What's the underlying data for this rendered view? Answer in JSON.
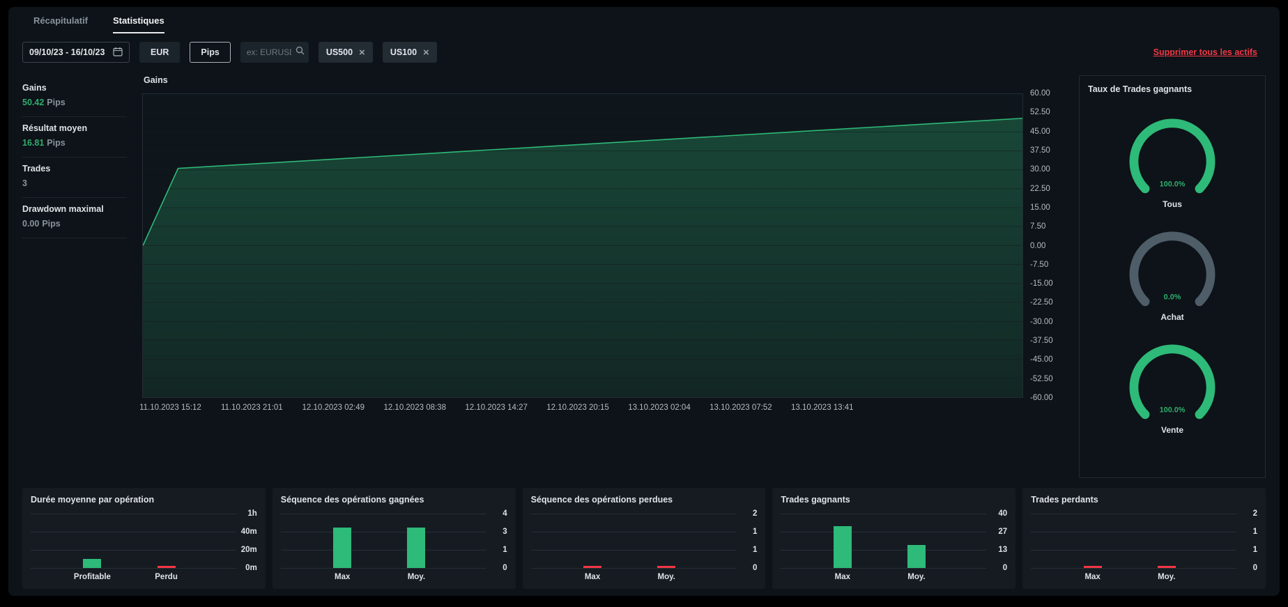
{
  "colors": {
    "bg": "#0d1318",
    "panel": "#151b21",
    "text": "#d6dade",
    "muted": "#8a929b",
    "accent-green": "#2eba78",
    "accent-green-text": "#2fad6e",
    "accent-red": "#f23645",
    "gauge-gray": "#4e5d68",
    "tick": "#b7bcc4",
    "border": "#232c33"
  },
  "tabs": [
    {
      "label": "Récapitulatif"
    },
    {
      "label": "Statistiques"
    }
  ],
  "toolbar": {
    "date_range": "09/10/23 - 16/10/23",
    "currency_button": "EUR",
    "unit_button": "Pips",
    "search_placeholder": "ex: EURUSD",
    "chips": [
      {
        "label": "US500",
        "remove": "×"
      },
      {
        "label": "US100",
        "remove": "×"
      }
    ],
    "remove_all_link": "Supprimer tous les actifs"
  },
  "stats": [
    {
      "id": "gains",
      "label": "Gains",
      "value": "50.42",
      "unit": "Pips",
      "tone": "green"
    },
    {
      "id": "resultat-moyen",
      "label": "Résultat moyen",
      "value": "16.81",
      "unit": "Pips",
      "tone": "green"
    },
    {
      "id": "trades",
      "label": "Trades",
      "value": "3",
      "unit": "",
      "tone": "muted"
    },
    {
      "id": "drawdown-maximal",
      "label": "Drawdown maximal",
      "value": "0.00",
      "unit": "Pips",
      "tone": "muted"
    }
  ],
  "chart_data": [
    {
      "id": "gains_line",
      "type": "area",
      "title": "Gains",
      "x_labels": [
        "11.10.2023 15:12",
        "11.10.2023 21:01",
        "12.10.2023 02:49",
        "12.10.2023 08:38",
        "12.10.2023 14:27",
        "12.10.2023 20:15",
        "13.10.2023 02:04",
        "13.10.2023 07:52",
        "13.10.2023 13:41"
      ],
      "y_tick_labels": [
        "60.00",
        "52.50",
        "45.00",
        "37.50",
        "30.00",
        "22.50",
        "15.00",
        "7.50",
        "0.00",
        "-7.50",
        "-15.00",
        "-22.50",
        "-30.00",
        "-37.50",
        "-45.00",
        "-52.50",
        "-60.00"
      ],
      "ylim": [
        -60,
        60
      ],
      "points": [
        {
          "x": 0,
          "y": 0
        },
        {
          "x": 0.04,
          "y": 30.6
        },
        {
          "x": 1,
          "y": 50.42
        }
      ]
    },
    {
      "id": "win_rate",
      "type": "gauge",
      "title": "Taux de Trades gagnants",
      "items": [
        {
          "label": "Tous",
          "value": 100,
          "display": "100.0%"
        },
        {
          "label": "Achat",
          "value": 0,
          "display": "0.0%"
        },
        {
          "label": "Vente",
          "value": 100,
          "display": "100.0%"
        }
      ]
    },
    {
      "id": "avg_duration",
      "type": "bar",
      "title": "Durée moyenne par opération",
      "categories": [
        "Profitable",
        "Perdu"
      ],
      "values": [
        10,
        0
      ],
      "bar_colors": [
        "green",
        "red"
      ],
      "y_ticks": [
        "1h",
        "40m",
        "20m",
        "0m"
      ],
      "ylim": [
        0,
        60
      ]
    },
    {
      "id": "win_streak",
      "type": "bar",
      "title": "Séquence des opérations gagnées",
      "categories": [
        "Max",
        "Moy."
      ],
      "values": [
        3,
        3
      ],
      "bar_colors": [
        "green",
        "green"
      ],
      "y_ticks": [
        "4",
        "3",
        "1",
        "0"
      ],
      "ylim": [
        0,
        4
      ]
    },
    {
      "id": "loss_streak",
      "type": "bar",
      "title": "Séquence des opérations perdues",
      "categories": [
        "Max",
        "Moy."
      ],
      "values": [
        0,
        0
      ],
      "bar_colors": [
        "red",
        "red"
      ],
      "y_ticks": [
        "2",
        "1",
        "1",
        "0"
      ],
      "ylim": [
        0,
        2
      ]
    },
    {
      "id": "winning_trades",
      "type": "bar",
      "title": "Trades gagnants",
      "categories": [
        "Max",
        "Moy."
      ],
      "values": [
        30.6,
        16.81
      ],
      "bar_colors": [
        "green",
        "green"
      ],
      "y_ticks": [
        "40",
        "27",
        "13",
        "0"
      ],
      "ylim": [
        0,
        40
      ]
    },
    {
      "id": "losing_trades",
      "type": "bar",
      "title": "Trades perdants",
      "categories": [
        "Max",
        "Moy."
      ],
      "values": [
        0,
        0
      ],
      "bar_colors": [
        "red",
        "red"
      ],
      "y_ticks": [
        "2",
        "1",
        "1",
        "0"
      ],
      "ylim": [
        0,
        2
      ]
    }
  ]
}
